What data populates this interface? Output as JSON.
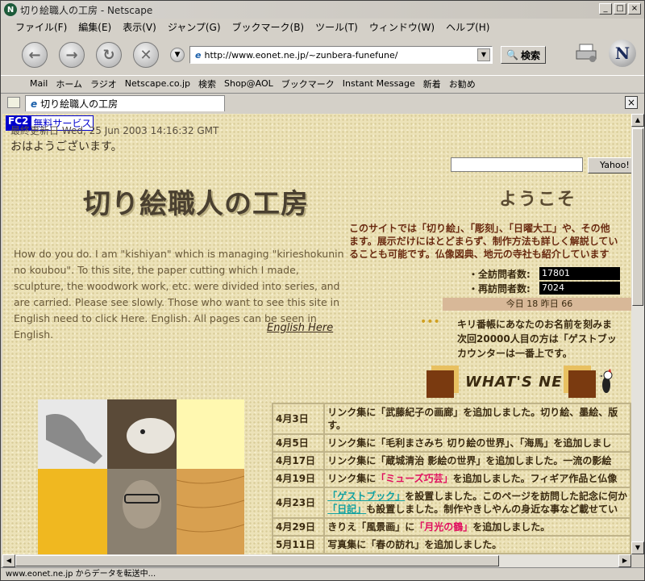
{
  "window": {
    "title": "切り絵職人の工房 - Netscape"
  },
  "menu": [
    "ファイル(F)",
    "編集(E)",
    "表示(V)",
    "ジャンプ(G)",
    "ブックマーク(B)",
    "ツール(T)",
    "ウィンドウ(W)",
    "ヘルプ(H)"
  ],
  "toolbar": {
    "url": "http://www.eonet.ne.jp/~zunbera-funefune/",
    "search_label": "検索"
  },
  "bookmarks": [
    "Mail",
    "ホーム",
    "ラジオ",
    "Netscape.co.jp",
    "検索",
    "Shop@AOL",
    "ブックマーク",
    "Instant Message",
    "新着",
    "お勧め"
  ],
  "tab": {
    "label": "切り絵職人の工房"
  },
  "page": {
    "fc2_a": "FC2",
    "fc2_b": "無料サービス",
    "updated": "最終更新日 Wed, 25 Jun 2003 14:16:32 GMT",
    "greeting": "おはようございます。",
    "site_logo": "切り絵職人の工房",
    "english_text": "How do you do. I am \"kishiyan\" which is managing \"kirieshokunin no koubou\". To this site, the paper cutting which I made, sculpture, the woodwork work, etc. were divided into series, and are carried. Please see slowly. Those who want to see this site in English need to click Here. English. All pages can be seen in English.",
    "english_link": "English Here",
    "yahoo_button": "Yahoo!",
    "welcome": "ようこそ",
    "intro_lines": [
      "このサイトでは「切り絵」、「彫刻」、「日曜大工」や、その他",
      "ます。展示だけにはとどまらず、制作方法も詳しく解説してい",
      "ることも可能です。仏像図典、地元の寺社も紹介しています"
    ],
    "counter_total_label": "・全訪問者数:",
    "counter_total": "17801",
    "counter_repeat_label": "・再訪問者数:",
    "counter_repeat": "7024",
    "today_yesterday": "今日 18 昨日 66",
    "kiriban_lines": [
      "キリ番帳にあなたのお名前を刻みま",
      "次回20000人目の方は「ゲストブッ",
      "カウンターは一番上です。"
    ],
    "whats_new": "WHAT'S NEW"
  },
  "news": [
    {
      "date": "4月3日",
      "text": "リンク集に「武藤紀子の画廊」を追加しました。切り絵、墨絵、版",
      "text2": "す。"
    },
    {
      "date": "4月5日",
      "text": "リンク集に「毛利まさみち 切り絵の世界」、「海馬」を追加しまし"
    },
    {
      "date": "4月17日",
      "text": "リンク集に「蔵城清治 影絵の世界」を追加しました。一流の影絵"
    },
    {
      "date": "4月19日",
      "pre": "リンク集に",
      "red": "「ミューズ巧芸」",
      "text": "を追加しました。フィギア作品と仏像"
    },
    {
      "date": "4月23日",
      "link1": "「ゲストブック」",
      "text": "を設置しました。このページを訪問した記念に何か",
      "link2": "「日記」",
      "text2": "も設置しました。制作やきしやんの身近な事など載せてい"
    },
    {
      "date": "4月29日",
      "pre": "きりえ「風景画」に",
      "red": "「月光の鶴」",
      "text": "を追加しました。"
    },
    {
      "date": "5月11日",
      "text": "写真集に「春の訪れ」を追加しました。"
    }
  ],
  "status": {
    "text": "www.eonet.ne.jp からデータを転送中..."
  }
}
